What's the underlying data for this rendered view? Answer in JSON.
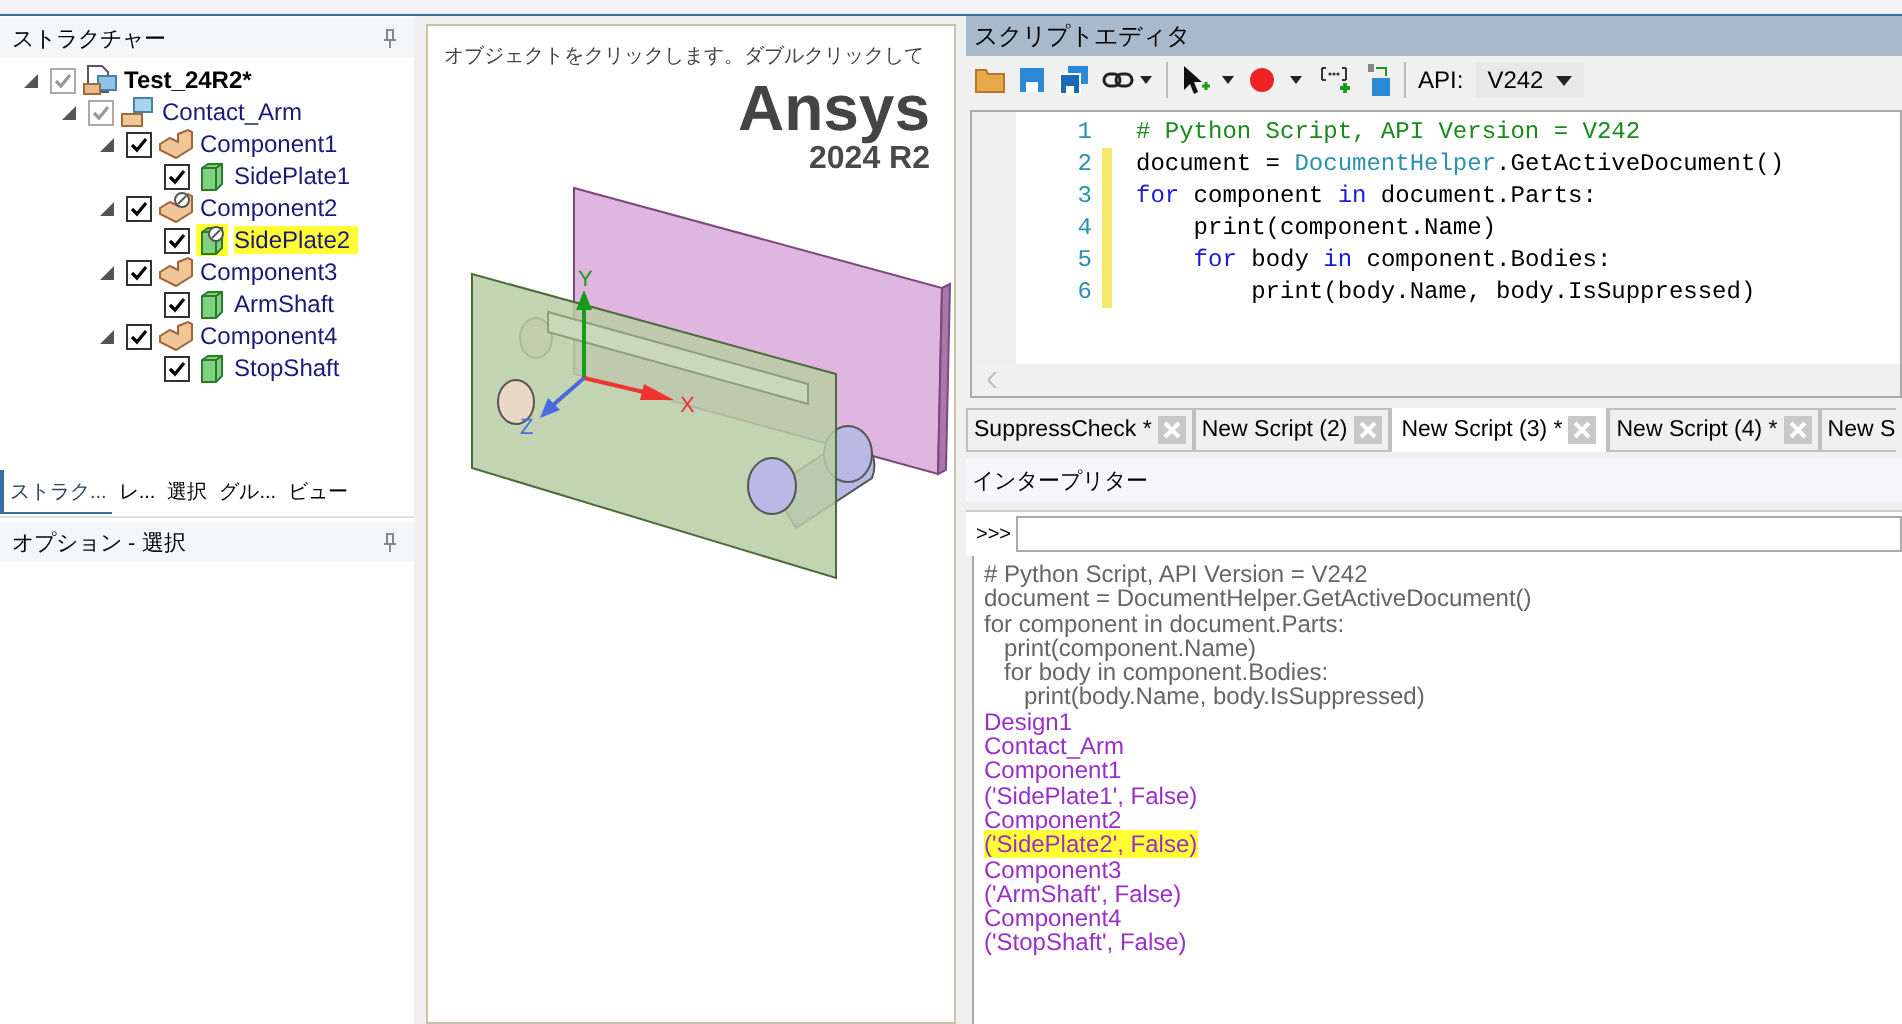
{
  "structure_panel": {
    "title": "ストラクチャー",
    "tree": [
      {
        "label": "Test_24R2*",
        "kind": "document",
        "checked": true,
        "dimmed": true,
        "expanded": true,
        "highlighted": false,
        "children": [
          {
            "label": "Contact_Arm",
            "kind": "assembly",
            "checked": true,
            "dimmed": true,
            "expanded": true,
            "highlighted": false,
            "children": [
              {
                "label": "Component1",
                "kind": "component",
                "checked": true,
                "dimmed": false,
                "expanded": true,
                "suppressed": false,
                "highlighted": false,
                "children": [
                  {
                    "label": "SidePlate1",
                    "kind": "body",
                    "checked": true,
                    "dimmed": false,
                    "suppressed": false,
                    "highlighted": false
                  }
                ]
              },
              {
                "label": "Component2",
                "kind": "component",
                "checked": true,
                "dimmed": false,
                "expanded": true,
                "suppressed": true,
                "highlighted": false,
                "children": [
                  {
                    "label": "SidePlate2",
                    "kind": "body",
                    "checked": true,
                    "dimmed": false,
                    "suppressed": true,
                    "highlighted": true
                  }
                ]
              },
              {
                "label": "Component3",
                "kind": "component",
                "checked": true,
                "dimmed": false,
                "expanded": true,
                "suppressed": false,
                "highlighted": false,
                "children": [
                  {
                    "label": "ArmShaft",
                    "kind": "body",
                    "checked": true,
                    "dimmed": false,
                    "suppressed": false,
                    "highlighted": false
                  }
                ]
              },
              {
                "label": "Component4",
                "kind": "component",
                "checked": true,
                "dimmed": false,
                "expanded": true,
                "suppressed": false,
                "highlighted": false,
                "children": [
                  {
                    "label": "StopShaft",
                    "kind": "body",
                    "checked": true,
                    "dimmed": false,
                    "suppressed": false,
                    "highlighted": false
                  }
                ]
              }
            ]
          }
        ]
      }
    ]
  },
  "panel_tabs": [
    {
      "label": "ストラク...",
      "selected": true
    },
    {
      "label": "レ...",
      "selected": false
    },
    {
      "label": "選択",
      "selected": false
    },
    {
      "label": "グル...",
      "selected": false
    },
    {
      "label": "ビュー",
      "selected": false
    }
  ],
  "options_panel": {
    "title": "オプション - 選択"
  },
  "viewport": {
    "hint": "オブジェクトをクリックします。ダブルクリックして",
    "logo": "Ansys",
    "version": "2024 R2",
    "axes": {
      "x": "X",
      "y": "Y",
      "z": "Z"
    }
  },
  "script_editor": {
    "title": "スクリプトエディタ",
    "api_label": "API:",
    "api_version": "V242",
    "lines": [
      {
        "number": "1",
        "changed": false,
        "tokens": [
          {
            "kind": "comment",
            "text": "# Python Script, API Version = V242"
          }
        ]
      },
      {
        "number": "2",
        "changed": true,
        "tokens": [
          {
            "kind": "plain",
            "text": "document = "
          },
          {
            "kind": "class",
            "text": "DocumentHelper"
          },
          {
            "kind": "plain",
            "text": ".GetActiveDocument()"
          }
        ]
      },
      {
        "number": "3",
        "changed": true,
        "tokens": [
          {
            "kind": "keyword",
            "text": "for"
          },
          {
            "kind": "plain",
            "text": " component "
          },
          {
            "kind": "keyword",
            "text": "in"
          },
          {
            "kind": "plain",
            "text": " document.Parts:"
          }
        ]
      },
      {
        "number": "4",
        "changed": true,
        "tokens": [
          {
            "kind": "plain",
            "text": "    print(component.Name)"
          }
        ]
      },
      {
        "number": "5",
        "changed": true,
        "tokens": [
          {
            "kind": "keyword",
            "text": "    for"
          },
          {
            "kind": "plain",
            "text": " body "
          },
          {
            "kind": "keyword",
            "text": "in"
          },
          {
            "kind": "plain",
            "text": " component.Bodies:"
          }
        ]
      },
      {
        "number": "6",
        "changed": true,
        "tokens": [
          {
            "kind": "plain",
            "text": "        print(body.Name, body.IsSuppressed)"
          }
        ]
      }
    ]
  },
  "script_tabs": [
    {
      "label": "SuppressCheck *",
      "selected": false,
      "clipped": false
    },
    {
      "label": "New Script (2)",
      "selected": false,
      "clipped": false
    },
    {
      "label": "New Script (3) *",
      "selected": true,
      "clipped": false
    },
    {
      "label": "New Script (4) *",
      "selected": false,
      "clipped": false
    },
    {
      "label": "New S",
      "selected": false,
      "clipped": true
    }
  ],
  "interpreter": {
    "title": "インタープリター",
    "prompt": ">>>",
    "output": [
      {
        "kind": "echo",
        "text": "# Python Script, API Version = V242",
        "highlighted": false
      },
      {
        "kind": "echo",
        "text": "document = DocumentHelper.GetActiveDocument()",
        "highlighted": false
      },
      {
        "kind": "echo",
        "text": "for component in document.Parts:",
        "highlighted": false
      },
      {
        "kind": "echo",
        "text": "   print(component.Name)",
        "highlighted": false
      },
      {
        "kind": "echo",
        "text": "   for body in component.Bodies:",
        "highlighted": false
      },
      {
        "kind": "echo",
        "text": "      print(body.Name, body.IsSuppressed)",
        "highlighted": false
      },
      {
        "kind": "result",
        "text": "Design1",
        "highlighted": false
      },
      {
        "kind": "result",
        "text": "Contact_Arm",
        "highlighted": false
      },
      {
        "kind": "result",
        "text": "Component1",
        "highlighted": false
      },
      {
        "kind": "result",
        "text": "('SidePlate1', False)",
        "highlighted": false
      },
      {
        "kind": "result",
        "text": "Component2",
        "highlighted": false
      },
      {
        "kind": "result",
        "text": "('SidePlate2', False)",
        "highlighted": true
      },
      {
        "kind": "result",
        "text": "Component3",
        "highlighted": false
      },
      {
        "kind": "result",
        "text": "('ArmShaft', False)",
        "highlighted": false
      },
      {
        "kind": "result",
        "text": "Component4",
        "highlighted": false
      },
      {
        "kind": "result",
        "text": "('StopShaft', False)",
        "highlighted": false
      }
    ]
  }
}
